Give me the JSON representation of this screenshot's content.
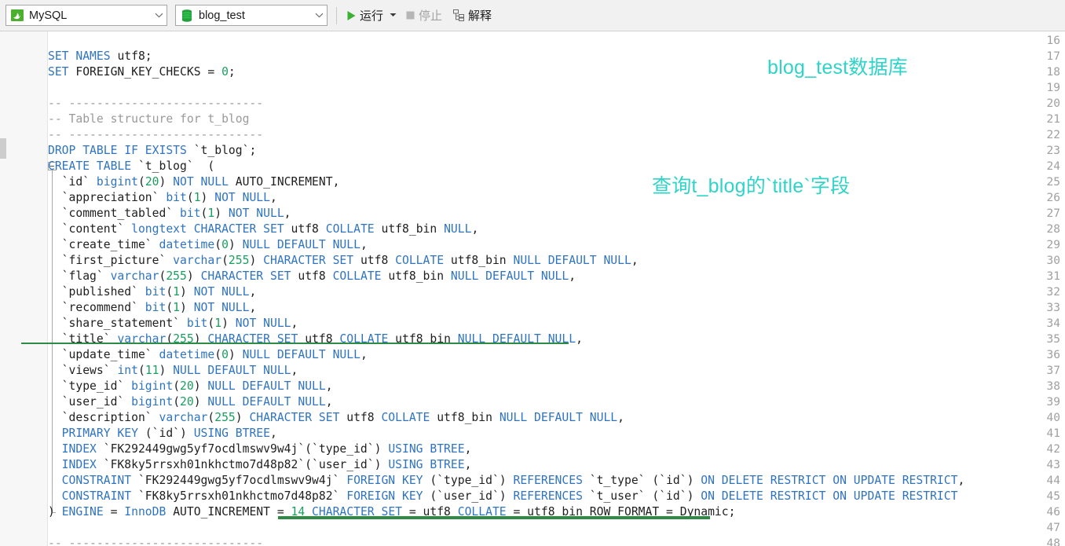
{
  "toolbar": {
    "connection": {
      "label": "MySQL",
      "icon": "mysql-dolphin-icon",
      "arrow": "chevron-down-icon"
    },
    "database": {
      "label": "blog_test",
      "icon": "database-cylinder-icon",
      "arrow": "chevron-down-icon"
    },
    "run": {
      "label": "运行",
      "icon": "play-triangle-icon",
      "caret": "dropdown-caret-icon",
      "enabled": true
    },
    "stop": {
      "label": "停止",
      "icon": "stop-square-icon",
      "enabled": false
    },
    "explain": {
      "label": "解释",
      "icon": "explain-plan-icon",
      "enabled": true
    }
  },
  "annotations": [
    {
      "text": "blog_test数据库",
      "color": "#2fd3c8"
    },
    {
      "text": "查询t_blog的`title`字段",
      "color": "#2fd3c8"
    }
  ],
  "highlights": {
    "color": "#2e8b45",
    "line35_underline": "underline beneath `title` column definition",
    "line46_underline": "underline beneath ENGINE/CHARACTER SET clause"
  },
  "editor": {
    "first_line_number": 16,
    "fold_marker_line": 24,
    "fold_end_line": 46,
    "lines": [
      {
        "n": 16,
        "tokens": []
      },
      {
        "n": 17,
        "tokens": [
          {
            "t": "kw",
            "s": "SET NAMES "
          },
          {
            "t": "pln",
            "s": "utf8;"
          }
        ]
      },
      {
        "n": 18,
        "tokens": [
          {
            "t": "kw",
            "s": "SET "
          },
          {
            "t": "pln",
            "s": "FOREIGN_KEY_CHECKS = "
          },
          {
            "t": "num",
            "s": "0"
          },
          {
            "t": "pln",
            "s": ";"
          }
        ]
      },
      {
        "n": 19,
        "tokens": []
      },
      {
        "n": 20,
        "tokens": [
          {
            "t": "cmt",
            "s": "-- ----------------------------"
          }
        ]
      },
      {
        "n": 21,
        "tokens": [
          {
            "t": "cmt",
            "s": "-- Table structure for t_blog"
          }
        ]
      },
      {
        "n": 22,
        "tokens": [
          {
            "t": "cmt",
            "s": "-- ----------------------------"
          }
        ]
      },
      {
        "n": 23,
        "tokens": [
          {
            "t": "kw",
            "s": "DROP TABLE IF EXISTS "
          },
          {
            "t": "pln",
            "s": "`t_blog`;"
          }
        ]
      },
      {
        "n": 24,
        "tokens": [
          {
            "t": "kw",
            "s": "CREATE TABLE "
          },
          {
            "t": "pln",
            "s": "`t_blog`  ("
          }
        ]
      },
      {
        "n": 25,
        "tokens": [
          {
            "t": "pln",
            "s": "  `id` "
          },
          {
            "t": "kw",
            "s": "bigint"
          },
          {
            "t": "pln",
            "s": "("
          },
          {
            "t": "num",
            "s": "20"
          },
          {
            "t": "pln",
            "s": ") "
          },
          {
            "t": "kw",
            "s": "NOT NULL "
          },
          {
            "t": "pln",
            "s": "AUTO_INCREMENT,"
          }
        ]
      },
      {
        "n": 26,
        "tokens": [
          {
            "t": "pln",
            "s": "  `appreciation` "
          },
          {
            "t": "kw",
            "s": "bit"
          },
          {
            "t": "pln",
            "s": "("
          },
          {
            "t": "num",
            "s": "1"
          },
          {
            "t": "pln",
            "s": ") "
          },
          {
            "t": "kw",
            "s": "NOT NULL"
          },
          {
            "t": "pln",
            "s": ","
          }
        ]
      },
      {
        "n": 27,
        "tokens": [
          {
            "t": "pln",
            "s": "  `comment_tabled` "
          },
          {
            "t": "kw",
            "s": "bit"
          },
          {
            "t": "pln",
            "s": "("
          },
          {
            "t": "num",
            "s": "1"
          },
          {
            "t": "pln",
            "s": ") "
          },
          {
            "t": "kw",
            "s": "NOT NULL"
          },
          {
            "t": "pln",
            "s": ","
          }
        ]
      },
      {
        "n": 28,
        "tokens": [
          {
            "t": "pln",
            "s": "  `content` "
          },
          {
            "t": "kw",
            "s": "longtext CHARACTER SET "
          },
          {
            "t": "pln",
            "s": "utf8 "
          },
          {
            "t": "kw",
            "s": "COLLATE "
          },
          {
            "t": "pln",
            "s": "utf8_bin "
          },
          {
            "t": "kw",
            "s": "NULL"
          },
          {
            "t": "pln",
            "s": ","
          }
        ]
      },
      {
        "n": 29,
        "tokens": [
          {
            "t": "pln",
            "s": "  `create_time` "
          },
          {
            "t": "kw",
            "s": "datetime"
          },
          {
            "t": "pln",
            "s": "("
          },
          {
            "t": "num",
            "s": "0"
          },
          {
            "t": "pln",
            "s": ") "
          },
          {
            "t": "kw",
            "s": "NULL DEFAULT NULL"
          },
          {
            "t": "pln",
            "s": ","
          }
        ]
      },
      {
        "n": 30,
        "tokens": [
          {
            "t": "pln",
            "s": "  `first_picture` "
          },
          {
            "t": "kw",
            "s": "varchar"
          },
          {
            "t": "pln",
            "s": "("
          },
          {
            "t": "num",
            "s": "255"
          },
          {
            "t": "pln",
            "s": ") "
          },
          {
            "t": "kw",
            "s": "CHARACTER SET "
          },
          {
            "t": "pln",
            "s": "utf8 "
          },
          {
            "t": "kw",
            "s": "COLLATE "
          },
          {
            "t": "pln",
            "s": "utf8_bin "
          },
          {
            "t": "kw",
            "s": "NULL DEFAULT NULL"
          },
          {
            "t": "pln",
            "s": ","
          }
        ]
      },
      {
        "n": 31,
        "tokens": [
          {
            "t": "pln",
            "s": "  `flag` "
          },
          {
            "t": "kw",
            "s": "varchar"
          },
          {
            "t": "pln",
            "s": "("
          },
          {
            "t": "num",
            "s": "255"
          },
          {
            "t": "pln",
            "s": ") "
          },
          {
            "t": "kw",
            "s": "CHARACTER SET "
          },
          {
            "t": "pln",
            "s": "utf8 "
          },
          {
            "t": "kw",
            "s": "COLLATE "
          },
          {
            "t": "pln",
            "s": "utf8_bin "
          },
          {
            "t": "kw",
            "s": "NULL DEFAULT NULL"
          },
          {
            "t": "pln",
            "s": ","
          }
        ]
      },
      {
        "n": 32,
        "tokens": [
          {
            "t": "pln",
            "s": "  `published` "
          },
          {
            "t": "kw",
            "s": "bit"
          },
          {
            "t": "pln",
            "s": "("
          },
          {
            "t": "num",
            "s": "1"
          },
          {
            "t": "pln",
            "s": ") "
          },
          {
            "t": "kw",
            "s": "NOT NULL"
          },
          {
            "t": "pln",
            "s": ","
          }
        ]
      },
      {
        "n": 33,
        "tokens": [
          {
            "t": "pln",
            "s": "  `recommend` "
          },
          {
            "t": "kw",
            "s": "bit"
          },
          {
            "t": "pln",
            "s": "("
          },
          {
            "t": "num",
            "s": "1"
          },
          {
            "t": "pln",
            "s": ") "
          },
          {
            "t": "kw",
            "s": "NOT NULL"
          },
          {
            "t": "pln",
            "s": ","
          }
        ]
      },
      {
        "n": 34,
        "tokens": [
          {
            "t": "pln",
            "s": "  `share_statement` "
          },
          {
            "t": "kw",
            "s": "bit"
          },
          {
            "t": "pln",
            "s": "("
          },
          {
            "t": "num",
            "s": "1"
          },
          {
            "t": "pln",
            "s": ") "
          },
          {
            "t": "kw",
            "s": "NOT NULL"
          },
          {
            "t": "pln",
            "s": ","
          }
        ]
      },
      {
        "n": 35,
        "tokens": [
          {
            "t": "pln",
            "s": "  `title` "
          },
          {
            "t": "kw",
            "s": "varchar"
          },
          {
            "t": "pln",
            "s": "("
          },
          {
            "t": "num",
            "s": "255"
          },
          {
            "t": "pln",
            "s": ") "
          },
          {
            "t": "kw",
            "s": "CHARACTER SET "
          },
          {
            "t": "pln",
            "s": "utf8 "
          },
          {
            "t": "kw",
            "s": "COLLATE "
          },
          {
            "t": "pln",
            "s": "utf8 bin "
          },
          {
            "t": "kw",
            "s": "NULL DEFAULT NULL"
          },
          {
            "t": "pln",
            "s": ","
          }
        ]
      },
      {
        "n": 36,
        "tokens": [
          {
            "t": "pln",
            "s": "  `update_time` "
          },
          {
            "t": "kw",
            "s": "datetime"
          },
          {
            "t": "pln",
            "s": "("
          },
          {
            "t": "num",
            "s": "0"
          },
          {
            "t": "pln",
            "s": ") "
          },
          {
            "t": "kw",
            "s": "NULL DEFAULT NULL"
          },
          {
            "t": "pln",
            "s": ","
          }
        ]
      },
      {
        "n": 37,
        "tokens": [
          {
            "t": "pln",
            "s": "  `views` "
          },
          {
            "t": "kw",
            "s": "int"
          },
          {
            "t": "pln",
            "s": "("
          },
          {
            "t": "num",
            "s": "11"
          },
          {
            "t": "pln",
            "s": ") "
          },
          {
            "t": "kw",
            "s": "NULL DEFAULT NULL"
          },
          {
            "t": "pln",
            "s": ","
          }
        ]
      },
      {
        "n": 38,
        "tokens": [
          {
            "t": "pln",
            "s": "  `type_id` "
          },
          {
            "t": "kw",
            "s": "bigint"
          },
          {
            "t": "pln",
            "s": "("
          },
          {
            "t": "num",
            "s": "20"
          },
          {
            "t": "pln",
            "s": ") "
          },
          {
            "t": "kw",
            "s": "NULL DEFAULT NULL"
          },
          {
            "t": "pln",
            "s": ","
          }
        ]
      },
      {
        "n": 39,
        "tokens": [
          {
            "t": "pln",
            "s": "  `user_id` "
          },
          {
            "t": "kw",
            "s": "bigint"
          },
          {
            "t": "pln",
            "s": "("
          },
          {
            "t": "num",
            "s": "20"
          },
          {
            "t": "pln",
            "s": ") "
          },
          {
            "t": "kw",
            "s": "NULL DEFAULT NULL"
          },
          {
            "t": "pln",
            "s": ","
          }
        ]
      },
      {
        "n": 40,
        "tokens": [
          {
            "t": "pln",
            "s": "  `description` "
          },
          {
            "t": "kw",
            "s": "varchar"
          },
          {
            "t": "pln",
            "s": "("
          },
          {
            "t": "num",
            "s": "255"
          },
          {
            "t": "pln",
            "s": ") "
          },
          {
            "t": "kw",
            "s": "CHARACTER SET "
          },
          {
            "t": "pln",
            "s": "utf8 "
          },
          {
            "t": "kw",
            "s": "COLLATE "
          },
          {
            "t": "pln",
            "s": "utf8_bin "
          },
          {
            "t": "kw",
            "s": "NULL DEFAULT NULL"
          },
          {
            "t": "pln",
            "s": ","
          }
        ]
      },
      {
        "n": 41,
        "tokens": [
          {
            "t": "kw",
            "s": "  PRIMARY KEY "
          },
          {
            "t": "pln",
            "s": "(`id`) "
          },
          {
            "t": "kw",
            "s": "USING BTREE"
          },
          {
            "t": "pln",
            "s": ","
          }
        ]
      },
      {
        "n": 42,
        "tokens": [
          {
            "t": "kw",
            "s": "  INDEX "
          },
          {
            "t": "pln",
            "s": "`FK292449gwg5yf7ocdlmswv9w4j`(`type_id`) "
          },
          {
            "t": "kw",
            "s": "USING BTREE"
          },
          {
            "t": "pln",
            "s": ","
          }
        ]
      },
      {
        "n": 43,
        "tokens": [
          {
            "t": "kw",
            "s": "  INDEX "
          },
          {
            "t": "pln",
            "s": "`FK8ky5rrsxh01nkhctmo7d48p82`(`user_id`) "
          },
          {
            "t": "kw",
            "s": "USING BTREE"
          },
          {
            "t": "pln",
            "s": ","
          }
        ]
      },
      {
        "n": 44,
        "tokens": [
          {
            "t": "kw",
            "s": "  CONSTRAINT "
          },
          {
            "t": "pln",
            "s": "`FK292449gwg5yf7ocdlmswv9w4j` "
          },
          {
            "t": "kw",
            "s": "FOREIGN KEY "
          },
          {
            "t": "pln",
            "s": "(`type_id`) "
          },
          {
            "t": "kw",
            "s": "REFERENCES "
          },
          {
            "t": "pln",
            "s": "`t_type` (`id`) "
          },
          {
            "t": "kw",
            "s": "ON DELETE RESTRICT ON UPDATE RESTRICT"
          },
          {
            "t": "pln",
            "s": ","
          }
        ]
      },
      {
        "n": 45,
        "tokens": [
          {
            "t": "kw",
            "s": "  CONSTRAINT "
          },
          {
            "t": "pln",
            "s": "`FK8ky5rrsxh01nkhctmo7d48p82` "
          },
          {
            "t": "kw",
            "s": "FOREIGN KEY "
          },
          {
            "t": "pln",
            "s": "(`user_id`) "
          },
          {
            "t": "kw",
            "s": "REFERENCES "
          },
          {
            "t": "pln",
            "s": "`t_user` (`id`) "
          },
          {
            "t": "kw",
            "s": "ON DELETE RESTRICT ON UPDATE RESTRICT"
          }
        ]
      },
      {
        "n": 46,
        "tokens": [
          {
            "t": "pln",
            "s": ") "
          },
          {
            "t": "kw",
            "s": "ENGINE "
          },
          {
            "t": "pln",
            "s": "= "
          },
          {
            "t": "kw",
            "s": "InnoDB "
          },
          {
            "t": "pln",
            "s": "AUTO_INCREMENT = "
          },
          {
            "t": "num",
            "s": "14"
          },
          {
            "t": "pln",
            "s": " "
          },
          {
            "t": "kw",
            "s": "CHARACTER SET "
          },
          {
            "t": "pln",
            "s": "= utf8 "
          },
          {
            "t": "kw",
            "s": "COLLATE "
          },
          {
            "t": "pln",
            "s": "= utf8_bin ROW_FORMAT = Dynamic;"
          }
        ]
      },
      {
        "n": 47,
        "tokens": []
      },
      {
        "n": 48,
        "tokens": [
          {
            "t": "cmt",
            "s": "-- ----------------------------"
          }
        ]
      }
    ]
  }
}
